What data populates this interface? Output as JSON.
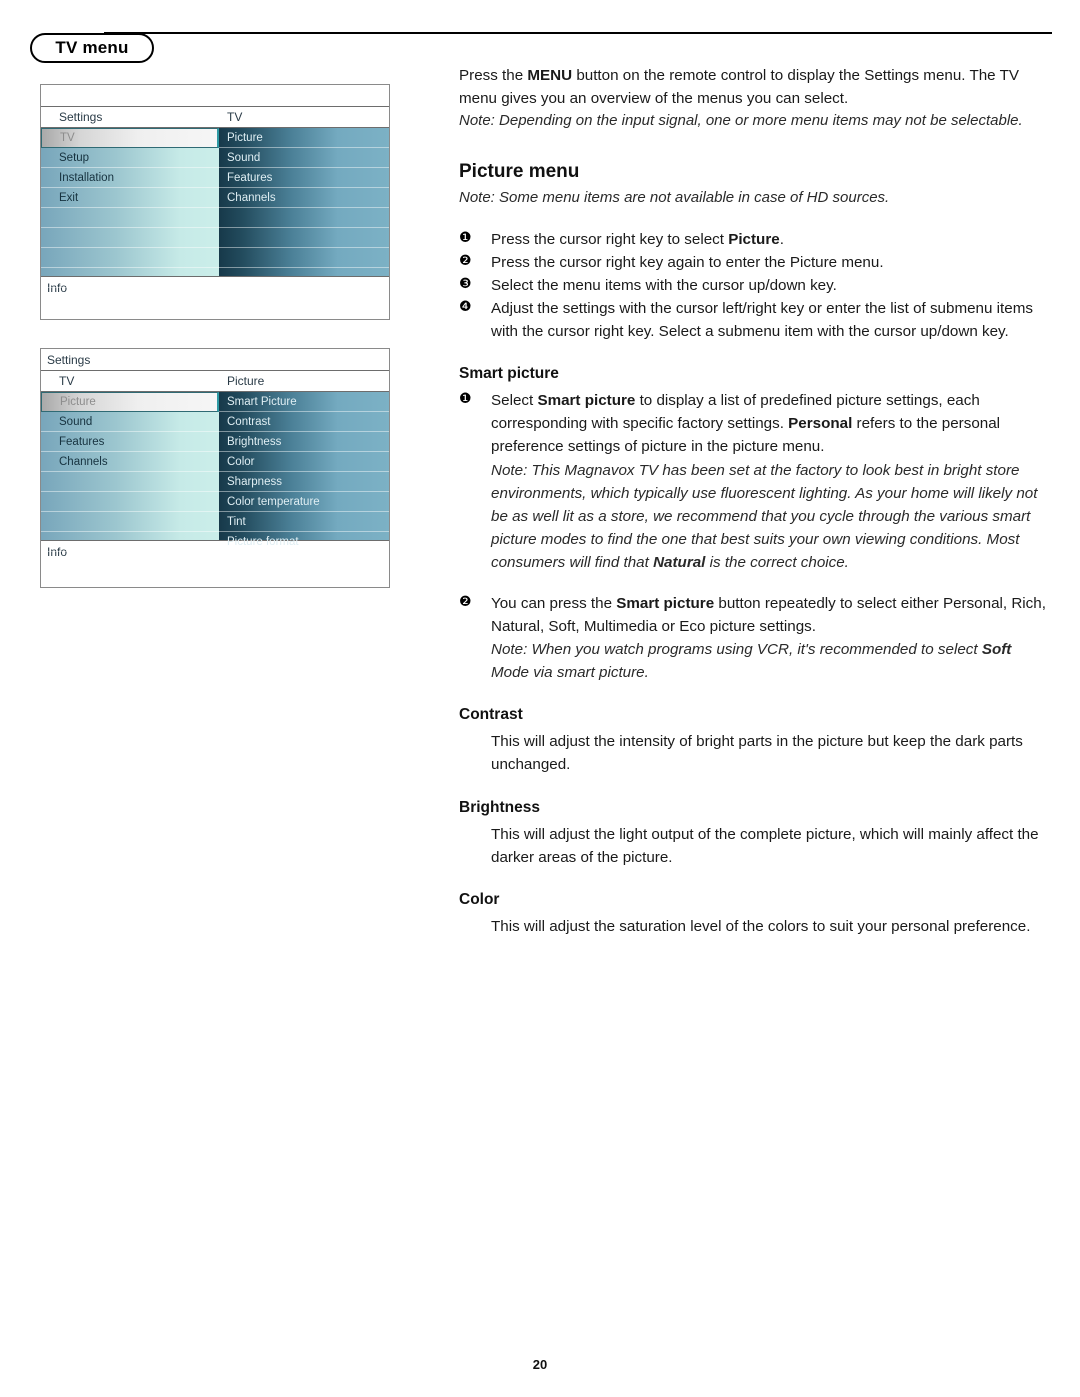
{
  "header": {
    "tab_label": "TV menu"
  },
  "osd_menus": [
    {
      "name": "tv-menu-screen",
      "title": "",
      "has_blank_row": true,
      "left_header": "Settings",
      "right_header": "TV",
      "left_items": [
        "TV",
        "Setup",
        "Installation",
        "Exit"
      ],
      "left_selected_index": 0,
      "right_items": [
        "Picture",
        "Sound",
        "Features",
        "Channels"
      ],
      "left_total_rows": 8,
      "right_total_rows": 8,
      "footer": "Info"
    },
    {
      "name": "picture-menu-screen",
      "title": "Settings",
      "has_blank_row": false,
      "left_header": "TV",
      "right_header": "Picture",
      "left_items": [
        "Picture",
        "Sound",
        "Features",
        "Channels"
      ],
      "left_selected_index": 0,
      "right_items": [
        "Smart Picture",
        "Contrast",
        "Brightness",
        "Color",
        "Sharpness",
        "Color temperature",
        "Tint",
        "Picture format"
      ],
      "left_total_rows": 8,
      "right_total_rows": 8,
      "footer": "Info"
    }
  ],
  "content": {
    "intro": {
      "line1_pre": "Press the ",
      "line1_bold": "MENU",
      "line1_post": " button on the remote control to display the Settings menu. The TV menu gives you an overview of the menus you can select.",
      "note": "Note: Depending on the input signal, one or more menu items may not be selectable."
    },
    "picture_menu": {
      "heading": "Picture menu",
      "note": "Note: Some menu items are not available in case of HD sources.",
      "steps": [
        {
          "bullet": "❶",
          "pre": "Press the cursor right key to select ",
          "bold": "Picture",
          "post": "."
        },
        {
          "bullet": "❷",
          "pre": "Press the cursor right key again to enter the Picture menu.",
          "bold": "",
          "post": ""
        },
        {
          "bullet": "❸",
          "pre": "Select the menu items with the cursor up/down key.",
          "bold": "",
          "post": ""
        },
        {
          "bullet": "❹",
          "pre": "Adjust the settings with the cursor left/right key or enter the list of submenu items with the cursor right key. Select a submenu item with the cursor up/down key.",
          "bold": "",
          "post": ""
        }
      ]
    },
    "smart_picture": {
      "heading": "Smart picture",
      "step1_bullet": "❶",
      "step1_pre": "Select ",
      "step1_bold1": "Smart picture",
      "step1_mid": " to display a list of predefined picture settings, each corresponding with specific factory settings. ",
      "step1_bold2": "Personal",
      "step1_post": " refers to the personal preference settings of picture in the picture menu.",
      "step1_note_pre": "Note: This Magnavox TV has been set at the factory to look best in bright store environments, which typically use fluorescent lighting. As your home will likely not be as well lit as a store, we recommend that you cycle through the various smart picture modes to find the one that best suits your own viewing conditions. Most consumers will find that ",
      "step1_note_bold": "Natural",
      "step1_note_post": " is the correct choice.",
      "step2_bullet": "❷",
      "step2_pre": "You can press the ",
      "step2_bold": "Smart picture",
      "step2_post": " button repeatedly to select either Personal, Rich, Natural, Soft, Multimedia or Eco picture settings.",
      "step2_note_pre": "Note: When you watch programs using VCR, it's recommended to select ",
      "step2_note_bold": "Soft",
      "step2_note_post": " Mode via smart picture."
    },
    "contrast": {
      "heading": "Contrast",
      "body": "This will adjust the intensity of bright parts in the picture but keep the dark parts unchanged."
    },
    "brightness": {
      "heading": "Brightness",
      "body": "This will adjust the light output of the complete picture, which will mainly affect the darker areas of the picture."
    },
    "color": {
      "heading": "Color",
      "body": "This will adjust the saturation level of the colors to suit your personal preference."
    }
  },
  "footer": {
    "page_number": "20"
  }
}
